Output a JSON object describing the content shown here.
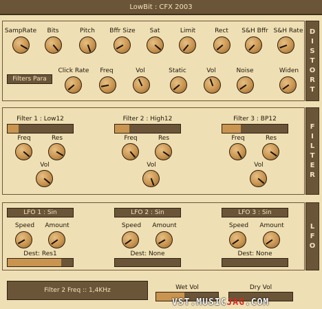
{
  "title": "LowBit : CFX 2003",
  "distort": {
    "tab_label": "DISTORT",
    "row1": [
      "SampRate",
      "Bits",
      "Pitch",
      "Bffr Size",
      "Sat",
      "Limit",
      "Rect",
      "S&H Bffr",
      "S&H Rate"
    ],
    "row2": [
      "Click Rate",
      "Freq",
      "Vol",
      "Static",
      "Vol",
      "Noise",
      "Widen"
    ],
    "mode_button": "Filters Para"
  },
  "filter": {
    "tab_label": "FILTER",
    "units": [
      {
        "name": "Filter 1 : Low12",
        "cutoff_fraction": 0.17,
        "knobs": [
          "Freq",
          "Res"
        ],
        "vol": "Vol"
      },
      {
        "name": "Filter 2 : High12",
        "cutoff_fraction": 0.22,
        "knobs": [
          "Freq",
          "Res"
        ],
        "vol": "Vol"
      },
      {
        "name": "Filter 3 : BP12",
        "cutoff_fraction": 0.28,
        "knobs": [
          "Freq",
          "Res"
        ],
        "vol": "Vol"
      }
    ]
  },
  "lfo": {
    "tab_label": "LFO",
    "units": [
      {
        "name": "LFO 1 : Sin",
        "knobs": [
          "Speed",
          "Amount"
        ],
        "dest": "Dest: Res1",
        "dest_fraction": 0.82
      },
      {
        "name": "LFO 2 : Sin",
        "knobs": [
          "Speed",
          "Amount"
        ],
        "dest": "Dest: None",
        "dest_fraction": 0
      },
      {
        "name": "LFO 3 : Sin",
        "knobs": [
          "Speed",
          "Amount"
        ],
        "dest": "Dest: None",
        "dest_fraction": 0
      }
    ]
  },
  "status": "Filter 2 Freq :: 1,4KHz",
  "wet_vol": {
    "label": "Wet Vol",
    "fraction": 0.45
  },
  "dry_vol": {
    "label": "Dry Vol",
    "fraction": 0
  },
  "watermark": {
    "part1": "VST.MUSIC",
    "part2": "JAG",
    "part3": ".COM"
  },
  "colors": {
    "background": "#efdfb4",
    "panel": "#6b5538",
    "knob": "#c9944f",
    "accent_text": "#f2e4bf",
    "watermark_red": "#d9281e"
  }
}
